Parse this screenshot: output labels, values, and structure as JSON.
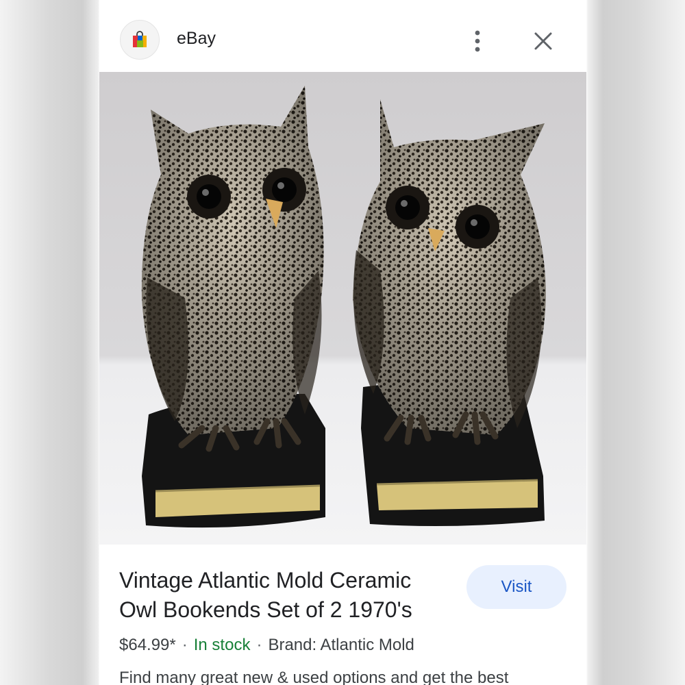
{
  "header": {
    "source_name": "eBay",
    "logo_icon": "shopping-bag-icon",
    "more_icon": "more-vert-icon",
    "close_icon": "close-icon"
  },
  "image": {
    "alt": "Vintage Atlantic Mold Ceramic Owl Bookends Set of 2 1970's"
  },
  "product": {
    "title": "Vintage Atlantic Mold Ceramic Owl Bookends Set of 2 1970's",
    "price": "$64.99*",
    "stock": "In stock",
    "brand": "Brand: Atlantic Mold",
    "separator": "·",
    "description": "Find many great new & used options and get the best"
  },
  "actions": {
    "visit_label": "Visit"
  },
  "colors": {
    "accent": "#1a56c5",
    "visit_bg": "#e8f0fe",
    "stock_green": "#188038",
    "text": "#202124"
  }
}
